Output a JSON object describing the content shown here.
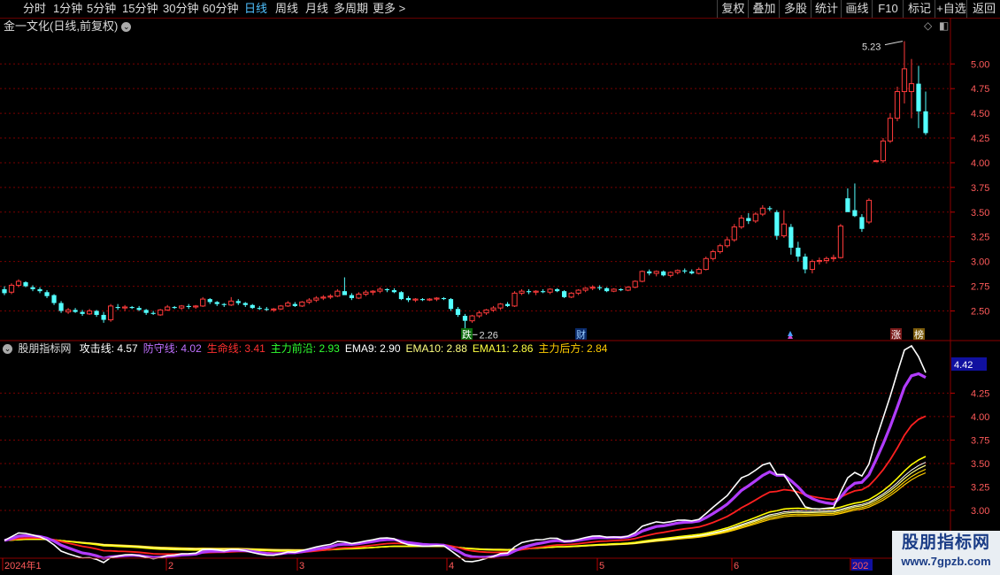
{
  "toolbar": {
    "timeframes": [
      "分时",
      "1分钟",
      "5分钟",
      "15分钟",
      "30分钟",
      "60分钟",
      "日线",
      "周线",
      "月线",
      "多周期",
      "更多 >"
    ],
    "active_index": 6,
    "tools": [
      "复权",
      "叠加",
      "多股",
      "统计",
      "画线",
      "F10",
      "标记",
      "+自选",
      "返回"
    ]
  },
  "title": {
    "text": "金一文化(日线,前复权)",
    "chevron_icon": "chevron-down-icon"
  },
  "corner_icons": [
    "diamond-icon",
    "window-toggle-icon"
  ],
  "colors": {
    "up": "#ff3b3b",
    "down": "#54ffff",
    "grid": "#7a0000",
    "attack": "#ffffff",
    "defend": "#b23cff",
    "life": "#ff2020",
    "main_front": "#ffff00",
    "ema9": "#ffffff",
    "ema10": "#ffff80",
    "ema11": "#ffd700",
    "main_rear": "#ffcc00"
  },
  "markers": {
    "fall": "跌",
    "finance": "财",
    "rise": "涨",
    "rank": "榜"
  },
  "indicator": {
    "name": "股朋指标网",
    "legend": [
      {
        "label": "攻击线: 4.57",
        "color": "#ffffff"
      },
      {
        "label": "防守线: 4.02",
        "color": "#c070ff"
      },
      {
        "label": "生命线: 3.41",
        "color": "#ff3030"
      },
      {
        "label": "主力前沿: 2.93",
        "color": "#30ff30"
      },
      {
        "label": "EMA9: 2.90",
        "color": "#ffffff"
      },
      {
        "label": "EMA10: 2.88",
        "color": "#ffff80"
      },
      {
        "label": "EMA11: 2.86",
        "color": "#ffff40"
      },
      {
        "label": "主力后方: 2.84",
        "color": "#ffcc00"
      }
    ],
    "current_value": "4.42"
  },
  "chart_data": [
    {
      "type": "candlestick",
      "ylim": [
        2.2,
        5.45
      ],
      "yticks": [
        "5.00",
        "4.75",
        "4.50",
        "4.25",
        "4.00",
        "3.75",
        "3.50",
        "3.25",
        "3.00",
        "2.75",
        "2.50"
      ],
      "annotations": [
        {
          "label": "5.23",
          "type": "high"
        },
        {
          "label": "2.26",
          "type": "low"
        }
      ],
      "ohlc": [
        [
          2.72,
          2.75,
          2.66,
          2.68
        ],
        [
          2.69,
          2.78,
          2.67,
          2.76
        ],
        [
          2.76,
          2.82,
          2.74,
          2.8
        ],
        [
          2.79,
          2.8,
          2.74,
          2.75
        ],
        [
          2.74,
          2.76,
          2.7,
          2.72
        ],
        [
          2.72,
          2.74,
          2.68,
          2.7
        ],
        [
          2.69,
          2.71,
          2.63,
          2.65
        ],
        [
          2.66,
          2.67,
          2.56,
          2.58
        ],
        [
          2.58,
          2.6,
          2.48,
          2.5
        ],
        [
          2.49,
          2.53,
          2.47,
          2.51
        ],
        [
          2.51,
          2.53,
          2.48,
          2.49
        ],
        [
          2.49,
          2.51,
          2.45,
          2.47
        ],
        [
          2.47,
          2.52,
          2.46,
          2.5
        ],
        [
          2.5,
          2.51,
          2.44,
          2.46
        ],
        [
          2.46,
          2.49,
          2.38,
          2.41
        ],
        [
          2.41,
          2.57,
          2.39,
          2.55
        ],
        [
          2.54,
          2.57,
          2.51,
          2.53
        ],
        [
          2.53,
          2.56,
          2.5,
          2.54
        ],
        [
          2.54,
          2.55,
          2.52,
          2.53
        ],
        [
          2.53,
          2.55,
          2.5,
          2.51
        ],
        [
          2.51,
          2.52,
          2.46,
          2.48
        ],
        [
          2.48,
          2.5,
          2.46,
          2.47
        ],
        [
          2.46,
          2.52,
          2.45,
          2.51
        ],
        [
          2.51,
          2.56,
          2.5,
          2.54
        ],
        [
          2.54,
          2.55,
          2.52,
          2.53
        ],
        [
          2.53,
          2.56,
          2.51,
          2.55
        ],
        [
          2.55,
          2.57,
          2.52,
          2.54
        ],
        [
          2.54,
          2.56,
          2.52,
          2.55
        ],
        [
          2.55,
          2.64,
          2.54,
          2.62
        ],
        [
          2.62,
          2.63,
          2.57,
          2.59
        ],
        [
          2.59,
          2.6,
          2.55,
          2.57
        ],
        [
          2.57,
          2.58,
          2.54,
          2.56
        ],
        [
          2.56,
          2.64,
          2.55,
          2.6
        ],
        [
          2.6,
          2.62,
          2.56,
          2.58
        ],
        [
          2.58,
          2.59,
          2.54,
          2.56
        ],
        [
          2.56,
          2.57,
          2.52,
          2.53
        ],
        [
          2.53,
          2.55,
          2.51,
          2.52
        ],
        [
          2.52,
          2.54,
          2.5,
          2.51
        ],
        [
          2.51,
          2.53,
          2.49,
          2.52
        ],
        [
          2.52,
          2.56,
          2.51,
          2.55
        ],
        [
          2.55,
          2.6,
          2.54,
          2.58
        ],
        [
          2.57,
          2.59,
          2.54,
          2.55
        ],
        [
          2.55,
          2.6,
          2.54,
          2.59
        ],
        [
          2.59,
          2.63,
          2.57,
          2.61
        ],
        [
          2.61,
          2.65,
          2.59,
          2.63
        ],
        [
          2.63,
          2.66,
          2.61,
          2.64
        ],
        [
          2.64,
          2.67,
          2.62,
          2.65
        ],
        [
          2.65,
          2.72,
          2.64,
          2.7
        ],
        [
          2.7,
          2.84,
          2.68,
          2.66
        ],
        [
          2.66,
          2.68,
          2.61,
          2.63
        ],
        [
          2.63,
          2.69,
          2.62,
          2.67
        ],
        [
          2.67,
          2.71,
          2.65,
          2.69
        ],
        [
          2.69,
          2.71,
          2.66,
          2.7
        ],
        [
          2.7,
          2.74,
          2.68,
          2.72
        ],
        [
          2.72,
          2.73,
          2.69,
          2.71
        ],
        [
          2.71,
          2.73,
          2.68,
          2.69
        ],
        [
          2.69,
          2.7,
          2.61,
          2.62
        ],
        [
          2.63,
          2.65,
          2.59,
          2.61
        ],
        [
          2.61,
          2.63,
          2.59,
          2.62
        ],
        [
          2.62,
          2.63,
          2.6,
          2.61
        ],
        [
          2.61,
          2.63,
          2.6,
          2.62
        ],
        [
          2.62,
          2.64,
          2.6,
          2.63
        ],
        [
          2.63,
          2.64,
          2.61,
          2.62
        ],
        [
          2.62,
          2.63,
          2.5,
          2.52
        ],
        [
          2.52,
          2.54,
          2.44,
          2.46
        ],
        [
          2.45,
          2.47,
          2.26,
          2.4
        ],
        [
          2.4,
          2.46,
          2.38,
          2.45
        ],
        [
          2.45,
          2.5,
          2.43,
          2.48
        ],
        [
          2.48,
          2.52,
          2.46,
          2.51
        ],
        [
          2.51,
          2.55,
          2.49,
          2.53
        ],
        [
          2.53,
          2.58,
          2.51,
          2.57
        ],
        [
          2.57,
          2.59,
          2.54,
          2.55
        ],
        [
          2.55,
          2.7,
          2.54,
          2.68
        ],
        [
          2.68,
          2.72,
          2.66,
          2.7
        ],
        [
          2.7,
          2.72,
          2.67,
          2.69
        ],
        [
          2.69,
          2.71,
          2.66,
          2.7
        ],
        [
          2.7,
          2.72,
          2.68,
          2.69
        ],
        [
          2.69,
          2.73,
          2.67,
          2.72
        ],
        [
          2.72,
          2.73,
          2.69,
          2.7
        ],
        [
          2.7,
          2.71,
          2.63,
          2.64
        ],
        [
          2.64,
          2.69,
          2.63,
          2.68
        ],
        [
          2.68,
          2.72,
          2.66,
          2.71
        ],
        [
          2.71,
          2.74,
          2.69,
          2.73
        ],
        [
          2.73,
          2.76,
          2.71,
          2.74
        ],
        [
          2.74,
          2.76,
          2.71,
          2.73
        ],
        [
          2.73,
          2.74,
          2.69,
          2.7
        ],
        [
          2.7,
          2.73,
          2.69,
          2.72
        ],
        [
          2.72,
          2.73,
          2.7,
          2.71
        ],
        [
          2.71,
          2.75,
          2.7,
          2.74
        ],
        [
          2.74,
          2.81,
          2.73,
          2.8
        ],
        [
          2.8,
          2.91,
          2.79,
          2.9
        ],
        [
          2.9,
          2.92,
          2.86,
          2.88
        ],
        [
          2.88,
          2.91,
          2.85,
          2.9
        ],
        [
          2.9,
          2.91,
          2.85,
          2.86
        ],
        [
          2.86,
          2.9,
          2.84,
          2.89
        ],
        [
          2.89,
          2.92,
          2.87,
          2.91
        ],
        [
          2.91,
          2.93,
          2.88,
          2.9
        ],
        [
          2.9,
          2.92,
          2.87,
          2.88
        ],
        [
          2.88,
          2.94,
          2.87,
          2.92
        ],
        [
          2.92,
          3.05,
          2.91,
          3.03
        ],
        [
          3.03,
          3.12,
          3.01,
          3.1
        ],
        [
          3.1,
          3.18,
          3.08,
          3.16
        ],
        [
          3.16,
          3.25,
          3.14,
          3.22
        ],
        [
          3.22,
          3.38,
          3.2,
          3.35
        ],
        [
          3.35,
          3.47,
          3.33,
          3.44
        ],
        [
          3.44,
          3.49,
          3.38,
          3.41
        ],
        [
          3.41,
          3.5,
          3.39,
          3.48
        ],
        [
          3.48,
          3.57,
          3.46,
          3.54
        ],
        [
          3.54,
          3.56,
          3.51,
          3.53
        ],
        [
          3.5,
          3.52,
          3.22,
          3.26
        ],
        [
          3.26,
          3.52,
          3.24,
          3.38
        ],
        [
          3.35,
          3.38,
          3.07,
          3.14
        ],
        [
          3.14,
          3.2,
          3.0,
          3.05
        ],
        [
          3.05,
          3.08,
          2.88,
          2.92
        ],
        [
          2.92,
          3.02,
          2.88,
          3.0
        ],
        [
          3.0,
          3.04,
          2.97,
          3.01
        ],
        [
          3.01,
          3.05,
          2.98,
          3.03
        ],
        [
          3.03,
          3.07,
          3.0,
          3.04
        ],
        [
          3.04,
          3.38,
          3.03,
          3.36
        ],
        [
          3.64,
          3.74,
          3.52,
          3.5
        ],
        [
          3.52,
          3.79,
          3.45,
          3.46
        ],
        [
          3.45,
          3.48,
          3.3,
          3.33
        ],
        [
          3.4,
          3.64,
          3.38,
          3.62
        ],
        [
          4.02,
          4.03,
          4.01,
          4.02
        ],
        [
          4.02,
          4.25,
          4.0,
          4.22
        ],
        [
          4.22,
          4.5,
          4.2,
          4.45
        ],
        [
          4.45,
          4.77,
          4.42,
          4.72
        ],
        [
          4.72,
          5.23,
          4.6,
          4.95
        ],
        [
          4.72,
          5.05,
          4.45,
          4.8
        ],
        [
          4.8,
          4.98,
          4.35,
          4.52
        ],
        [
          4.52,
          4.72,
          4.28,
          4.3
        ]
      ]
    },
    {
      "type": "line",
      "ylim": [
        2.5,
        4.65
      ],
      "yticks": [
        "4.25",
        "4.00",
        "3.75",
        "3.50",
        "3.25",
        "3.00"
      ],
      "xlabels": [
        "2024年1",
        "2",
        "3",
        "4",
        "5",
        "6",
        "202"
      ],
      "series": [
        {
          "name": "攻击线",
          "color": "#ffffff"
        },
        {
          "name": "防守线",
          "color": "#b23cff"
        },
        {
          "name": "生命线",
          "color": "#ff2020"
        },
        {
          "name": "主力前沿",
          "color": "#30ff30"
        },
        {
          "name": "EMA9",
          "color": "#ffffff"
        },
        {
          "name": "EMA10",
          "color": "#ffff80"
        },
        {
          "name": "EMA11",
          "color": "#ffff40"
        },
        {
          "name": "主力后方",
          "color": "#ffcc00"
        }
      ]
    }
  ]
}
